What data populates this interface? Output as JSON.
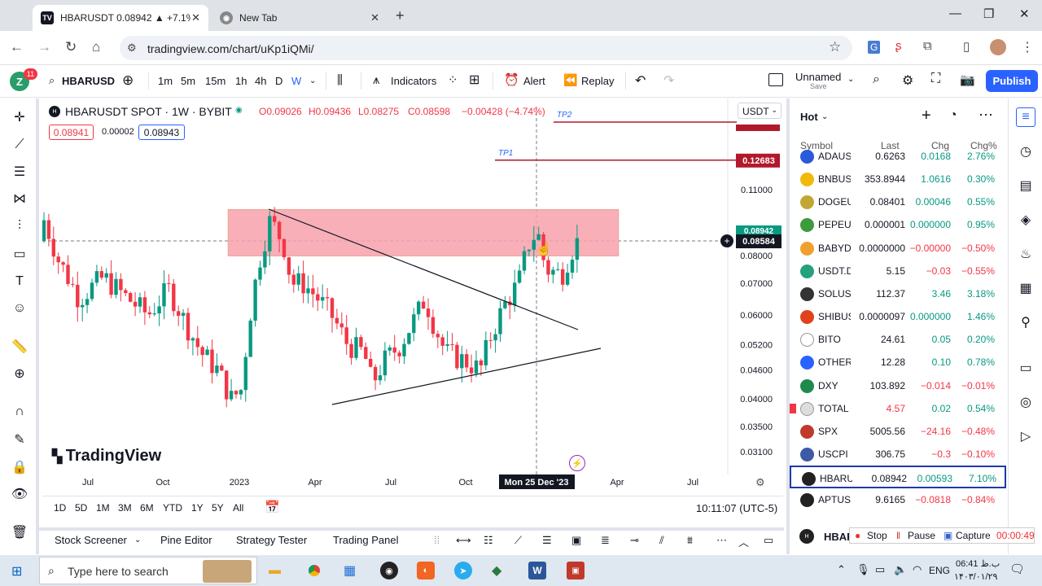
{
  "browser": {
    "tabs": [
      {
        "label": "HBARUSDT 0.08942 ▲ +7.1% U",
        "icon": "tradingview-logo-icon"
      },
      {
        "label": "New Tab",
        "icon": "chrome-icon"
      }
    ],
    "url": "tradingview.com/chart/uKp1iQMi/"
  },
  "tv": {
    "notif_count": "11",
    "symbol": "HBARUSD",
    "intervals": [
      "1m",
      "5m",
      "15m",
      "1h",
      "4h",
      "D",
      "W"
    ],
    "active_interval": "W",
    "indicators_label": "Indicators",
    "alert_label": "Alert",
    "replay_label": "Replay",
    "layout_name": "Unnamed",
    "layout_status": "Save",
    "publish_label": "Publish"
  },
  "chart": {
    "title": "HBARUSDT SPOT · 1W · BYBIT",
    "open": "O0.09026",
    "high": "H0.09436",
    "low": "L0.08275",
    "close": "C0.08598",
    "change": "−0.00428 (−4.74%)",
    "bid": "0.08941",
    "spread": "0.00002",
    "ask": "0.08943",
    "currency": "USDT",
    "watermark": "TradingView",
    "tp1": "TP1",
    "tp2": "TP2",
    "tp1_price": "0.12683",
    "price_top": "0.08942",
    "price_current": "0.08584",
    "crosshair_date": "Mon 25 Dec '23",
    "colors": {
      "up": "#089981",
      "down": "#f23645",
      "zone": "#f7a1ab",
      "tp": "#b2182b"
    }
  },
  "chart_data": {
    "type": "candlestick",
    "title": "HBARUSDT SPOT · 1W · BYBIT",
    "x_ticks": [
      "Jul",
      "Oct",
      "2023",
      "Apr",
      "Jul",
      "Oct",
      "Mon 25 Dec '23",
      "Apr",
      "Jul"
    ],
    "y_ticks": [
      "0.11000",
      "0.08000",
      "0.07000",
      "0.06000",
      "0.05200",
      "0.04600",
      "0.04000",
      "0.03500",
      "0.03100"
    ],
    "zone": {
      "low": 0.0798,
      "high": 0.1
    },
    "levels": [
      {
        "name": "TP1",
        "value": 0.12683
      },
      {
        "name": "TP2",
        "value": 0.16
      }
    ],
    "last": 0.08584,
    "log_scale": true
  },
  "range": {
    "buttons": [
      "1D",
      "5D",
      "1M",
      "3M",
      "6M",
      "YTD",
      "1Y",
      "5Y",
      "All"
    ],
    "clock": "10:11:07 (UTC-5)"
  },
  "bottom_tabs": [
    "Stock Screener",
    "Pine Editor",
    "Strategy Tester",
    "Trading Panel"
  ],
  "watchlist": {
    "title": "Hot",
    "headers": {
      "symbol": "Symbol",
      "last": "Last",
      "chg": "Chg",
      "pct": "Chg%"
    },
    "rows": [
      {
        "sym": "ADAUS",
        "last": "0.6263",
        "chg": "0.0168",
        "pct": "2.76%",
        "dir": "up",
        "logo": "#2a5ada"
      },
      {
        "sym": "BNBUS",
        "last": "353.8944",
        "chg": "1.0616",
        "pct": "0.30%",
        "dir": "up",
        "logo": "#f0b90b"
      },
      {
        "sym": "DOGEU",
        "last": "0.08401",
        "chg": "0.00046",
        "pct": "0.55%",
        "dir": "up",
        "logo": "#c2a633"
      },
      {
        "sym": "PEPEU",
        "last": "0.000001",
        "chg": "0.000000",
        "pct": "0.95%",
        "dir": "up",
        "logo": "#3d9a3d"
      },
      {
        "sym": "BABYD",
        "last": "0.0000000",
        "chg": "−0.00000",
        "pct": "−0.50%",
        "dir": "dn",
        "logo": "#f0a030"
      },
      {
        "sym": "USDT.D",
        "last": "5.15",
        "chg": "−0.03",
        "pct": "−0.55%",
        "dir": "dn",
        "logo": "#26a17b"
      },
      {
        "sym": "SOLUS",
        "last": "112.37",
        "chg": "3.46",
        "pct": "3.18%",
        "dir": "up",
        "logo": "#333333"
      },
      {
        "sym": "SHIBUS",
        "last": "0.0000097",
        "chg": "0.000000",
        "pct": "1.46%",
        "dir": "up",
        "logo": "#e0421b"
      },
      {
        "sym": "BITO",
        "last": "24.61",
        "chg": "0.05",
        "pct": "0.20%",
        "dir": "up",
        "logo": "#ffffff"
      },
      {
        "sym": "OTHER",
        "last": "12.28",
        "chg": "0.10",
        "pct": "0.78%",
        "dir": "up",
        "logo": "#2962ff"
      },
      {
        "sym": "DXY",
        "last": "103.892",
        "chg": "−0.014",
        "pct": "−0.01%",
        "dir": "dn",
        "logo": "#1e8b4d"
      },
      {
        "sym": "TOTAL",
        "last": "4.57",
        "chg": "0.02",
        "pct": "0.54%",
        "dir": "up",
        "logo": "#dddddd"
      },
      {
        "sym": "SPX",
        "last": "5005.56",
        "chg": "−24.16",
        "pct": "−0.48%",
        "dir": "dn",
        "logo": "#c0392b"
      },
      {
        "sym": "USCPI",
        "last": "306.75",
        "chg": "−0.3",
        "pct": "−0.10%",
        "dir": "dn",
        "logo": "#3c5aa6"
      },
      {
        "sym": "HBARU",
        "last": "0.08942",
        "chg": "0.00593",
        "pct": "7.10%",
        "dir": "up",
        "logo": "#222222"
      },
      {
        "sym": "APTUS",
        "last": "9.6165",
        "chg": "−0.0818",
        "pct": "−0.84%",
        "dir": "dn",
        "logo": "#222222"
      }
    ],
    "footer_symbol": "HBAR"
  },
  "recorder": {
    "stop": "Stop",
    "pause": "Pause",
    "capture": "Capture",
    "time": "00:00:49"
  },
  "taskbar": {
    "search_placeholder": "Type here to search",
    "lang": "ENG",
    "time": "06:41 ب.ظ",
    "date": "۱۴۰۳/۰۱/۲۹"
  }
}
